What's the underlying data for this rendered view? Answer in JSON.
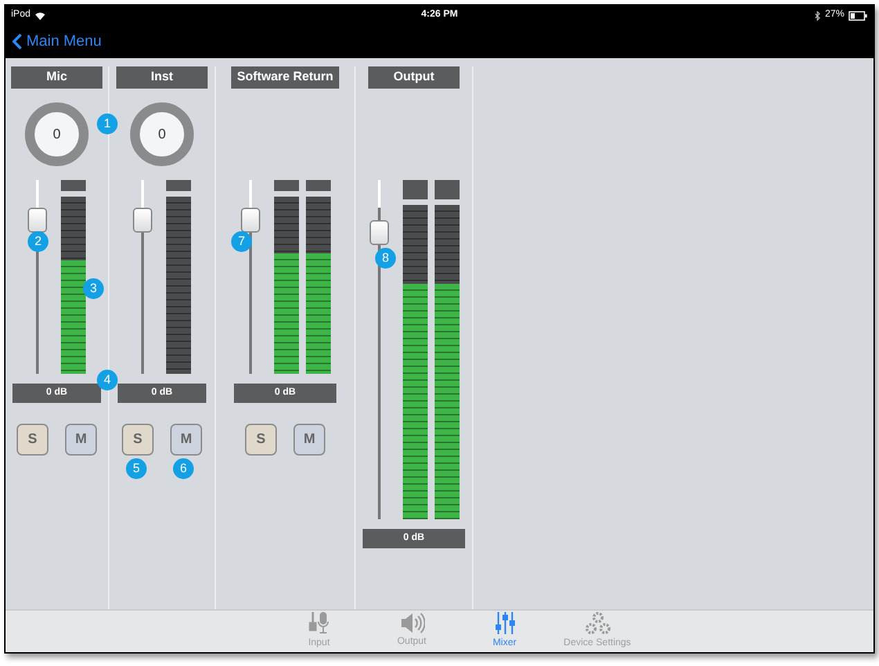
{
  "status_bar": {
    "device": "iPod",
    "time": "4:26 PM",
    "battery": "27%"
  },
  "nav": {
    "back": "Main Menu"
  },
  "channels": [
    {
      "name": "Mic",
      "knob": "0",
      "fader": {
        "level": 0.86
      },
      "meters": [
        {
          "level": 0.64
        }
      ],
      "readout": "0 dB",
      "solo": "S",
      "mute": "M"
    },
    {
      "name": "Inst",
      "knob": "0",
      "fader": {
        "level": 0.86
      },
      "meters": [
        {
          "level": 0
        }
      ],
      "readout": "0 dB",
      "solo": "S",
      "mute": "M"
    },
    {
      "name": "Software Return",
      "fader": {
        "level": 0.86
      },
      "meters": [
        {
          "level": 0.68
        },
        {
          "level": 0.68
        }
      ],
      "readout": "0 dB",
      "solo": "S",
      "mute": "M"
    },
    {
      "name": "Output",
      "fader": {
        "level": 0.88
      },
      "meters": [
        {
          "level": 0.75
        },
        {
          "level": 0.75
        }
      ],
      "readout": "0 dB"
    }
  ],
  "callouts": [
    "1",
    "2",
    "3",
    "4",
    "5",
    "6",
    "7",
    "8"
  ],
  "tabs": [
    {
      "label": "Input",
      "kind": "input",
      "selected": false
    },
    {
      "label": "Output",
      "kind": "output",
      "selected": false
    },
    {
      "label": "Mixer",
      "kind": "mixer",
      "selected": true
    },
    {
      "label": "Device Settings",
      "kind": "settings",
      "selected": false
    }
  ]
}
